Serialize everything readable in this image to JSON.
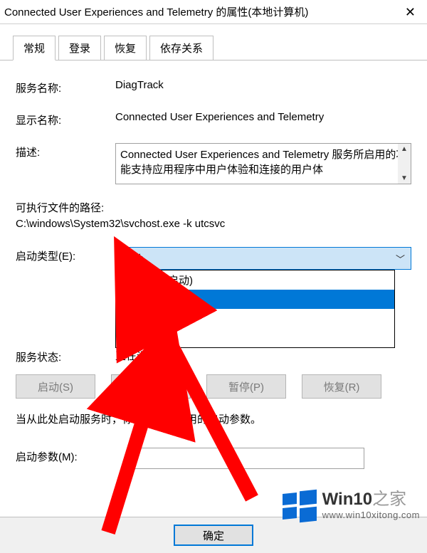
{
  "window": {
    "title": "Connected User Experiences and Telemetry 的属性(本地计算机)",
    "close_glyph": "✕"
  },
  "tabs": {
    "t0": "常规",
    "t1": "登录",
    "t2": "恢复",
    "t3": "依存关系"
  },
  "fields": {
    "service_name_label": "服务名称:",
    "service_name_value": "DiagTrack",
    "display_name_label": "显示名称:",
    "display_name_value": "Connected User Experiences and Telemetry",
    "description_label": "描述:",
    "description_value": "Connected User Experiences and Telemetry 服务所启用的功能支持应用程序中用户体验和连接的用户体",
    "exe_path_label": "可执行文件的路径:",
    "exe_path_value": "C:\\windows\\System32\\svchost.exe -k utcsvc",
    "startup_type_label": "启动类型(E):",
    "startup_type_value": "自动",
    "service_status_label": "服务状态:",
    "service_status_value": "正在运行",
    "hint_text": "当从此处启动服务时，你可指定所适用的启动参数。",
    "start_param_label": "启动参数(M):",
    "start_param_value": ""
  },
  "startup_options": {
    "o0": "自动(延迟启动)",
    "o1": "自动",
    "o2": "手动",
    "o3": "禁用"
  },
  "buttons": {
    "start": "启动(S)",
    "stop": "停止(T)",
    "pause": "暂停(P)",
    "resume": "恢复(R)",
    "ok": "确定"
  },
  "watermark": {
    "main_a": "Win10",
    "main_b": "之家",
    "sub": "www.win10xitong.com"
  },
  "annotation": {
    "arrow_color": "#ff0000"
  }
}
